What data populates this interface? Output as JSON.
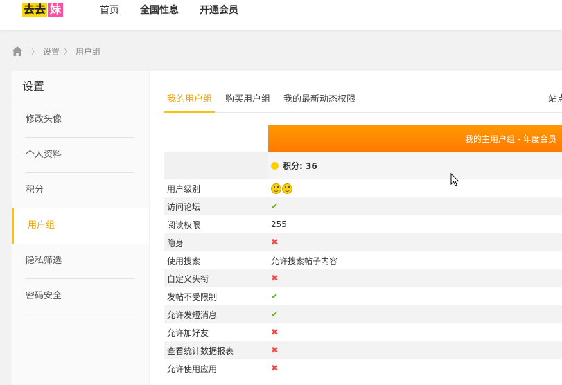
{
  "logo": {
    "part1": "去去",
    "part2": "妹"
  },
  "nav": {
    "items": [
      "首页",
      "全国性息",
      "开通会员"
    ]
  },
  "breadcrumb": {
    "items": [
      "设置",
      "用户组"
    ]
  },
  "sidebar": {
    "title": "设置",
    "items": [
      "修改头像",
      "个人资料",
      "积分",
      "用户组",
      "隐私筛选",
      "密码安全"
    ],
    "active_index": 3
  },
  "tabs": {
    "items": [
      "我的用户组",
      "购买用户组",
      "我的最新动态权限"
    ],
    "right": "站点"
  },
  "table": {
    "header": "我的主用户组 - 年度会员",
    "score": "积分: 36",
    "rows": [
      {
        "label": "用户级别",
        "value": "",
        "type": "smileys"
      },
      {
        "label": "访问论坛",
        "value": "✔",
        "type": "check"
      },
      {
        "label": "阅读权限",
        "value": "255",
        "type": "text"
      },
      {
        "label": "隐身",
        "value": "✖",
        "type": "cross"
      },
      {
        "label": "使用搜索",
        "value": "允许搜索帖子内容",
        "type": "text"
      },
      {
        "label": "自定义头衔",
        "value": "✖",
        "type": "cross"
      },
      {
        "label": "发帖不受限制",
        "value": "✔",
        "type": "check"
      },
      {
        "label": "允许发短消息",
        "value": "✔",
        "type": "check"
      },
      {
        "label": "允许加好友",
        "value": "✖",
        "type": "cross"
      },
      {
        "label": "查看统计数据报表",
        "value": "✖",
        "type": "cross"
      },
      {
        "label": "允许使用应用",
        "value": "✖",
        "type": "cross"
      }
    ]
  },
  "colors": {
    "accent": "#ffc107",
    "header_orange": "#ff8c00",
    "check": "#6cb52b",
    "cross": "#f04a4a"
  }
}
